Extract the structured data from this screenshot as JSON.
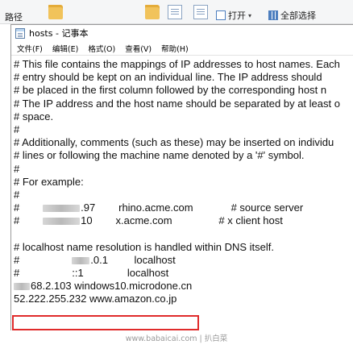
{
  "explorer_ribbon": {
    "path_label": "路径",
    "open_button": "打开",
    "select_all_button": "全部选择"
  },
  "window": {
    "title": "hosts - 记事本"
  },
  "menu": [
    "文件(F)",
    "编辑(E)",
    "格式(O)",
    "查看(V)",
    "帮助(H)"
  ],
  "editor_lines": [
    "# This file contains the mappings of IP addresses to host names. Each",
    "# entry should be kept on an individual line. The IP address should",
    "# be placed in the first column followed by the corresponding host n",
    "# The IP address and the host name should be separated by at least o",
    "# space.",
    "#",
    "# Additionally, comments (such as these) may be inserted on individu",
    "# lines or following the machine name denoted by a '#' symbol.",
    "#",
    "# For example:",
    "#",
    "#        ▒▒▒.97     rhino.acme.com          # source server",
    "#        ▒▒▒10     x.acme.com              # x client host",
    "",
    "# localhost name resolution is handled within DNS itself.",
    "#               ▒.0.1       localhost",
    "#               ::1             localhost",
    "▒68.2.103 windows10.microdone.cn",
    "52.222.255.232 www.amazon.co.jp"
  ],
  "sample_lines": {
    "line1_ip_tail": ".97",
    "line1_host": "rhino.acme.com",
    "line1_comment": "# source server",
    "line2_ip_tail": "10",
    "line2_host": "x.acme.com",
    "line2_comment": "# x client host",
    "lh1_ip_tail": ".0.1",
    "lh1_host": "localhost",
    "lh2_ip": "::1",
    "lh2_host": "localhost",
    "custom_ip_tail": "68.2.103",
    "custom_host": "windows10.microdone.cn"
  },
  "highlighted_entry": "52.222.255.232 www.amazon.co.jp",
  "watermark": "www.babaicai.com | 扒白菜",
  "colors": {
    "highlight_border": "#e02b2b",
    "text": "#111111"
  }
}
